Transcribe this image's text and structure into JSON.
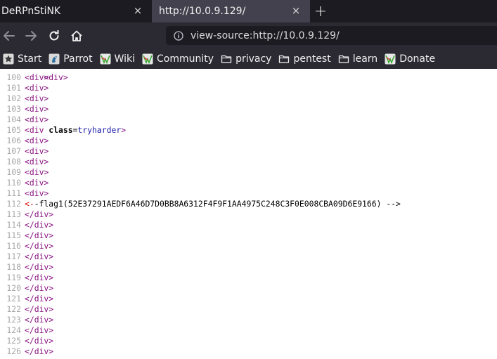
{
  "tabs": [
    {
      "title": "DeRPnStiNK",
      "active": false,
      "close_icon": "×"
    },
    {
      "title": "http://10.0.9.129/",
      "active": true,
      "close_icon": "×"
    }
  ],
  "new_tab_icon": "+",
  "nav": {
    "url": "view-source:http://10.0.9.129/"
  },
  "bookmarks": [
    {
      "label": "Start",
      "icon": "star-icon"
    },
    {
      "label": "Parrot",
      "icon": "parrot-icon"
    },
    {
      "label": "Wiki",
      "icon": "wiki-icon"
    },
    {
      "label": "Community",
      "icon": "community-icon"
    },
    {
      "label": "privacy",
      "icon": "folder-icon"
    },
    {
      "label": "pentest",
      "icon": "folder-icon"
    },
    {
      "label": "learn",
      "icon": "folder-icon"
    },
    {
      "label": "Donate",
      "icon": "donate-icon"
    }
  ],
  "source": {
    "partial_top_line": "<div>",
    "lines": [
      {
        "n": "100",
        "text": "<div>"
      },
      {
        "n": "101",
        "text": "<div>"
      },
      {
        "n": "102",
        "text": "<div>"
      },
      {
        "n": "103",
        "text": "<div>"
      },
      {
        "n": "104",
        "text": "<div>"
      },
      {
        "n": "105",
        "text": "<div class=tryharder>"
      },
      {
        "n": "106",
        "text": "<div>"
      },
      {
        "n": "107",
        "text": "<div>"
      },
      {
        "n": "108",
        "text": "<div>"
      },
      {
        "n": "109",
        "text": "<div>"
      },
      {
        "n": "110",
        "text": "<div>"
      },
      {
        "n": "111",
        "text": "<div>"
      },
      {
        "n": "112",
        "text": "<--flag1(52E37291AEDF6A46D7D0BB8A6312F4F9F1AA4975C248C3F0E008CBA09D6E9166) -->"
      },
      {
        "n": "113",
        "text": "</div>"
      },
      {
        "n": "114",
        "text": "</div>"
      },
      {
        "n": "115",
        "text": "</div>"
      },
      {
        "n": "116",
        "text": "</div>"
      },
      {
        "n": "117",
        "text": "</div>"
      },
      {
        "n": "118",
        "text": "</div>"
      },
      {
        "n": "119",
        "text": "</div>"
      },
      {
        "n": "120",
        "text": "</div>"
      },
      {
        "n": "121",
        "text": "</div>"
      },
      {
        "n": "122",
        "text": "</div>"
      },
      {
        "n": "123",
        "text": "</div>"
      },
      {
        "n": "124",
        "text": "</div>"
      },
      {
        "n": "125",
        "text": "</div>"
      },
      {
        "n": "126",
        "text": "</div>"
      }
    ]
  },
  "colors": {
    "tabbar_bg": "#1c1b22",
    "active_tab_bg": "#42414d",
    "toolbar_bg": "#2b2a33",
    "tag_color": "#881280",
    "attr_value_color": "#1a1aa6",
    "line_number_color": "#a7a7a7",
    "comment_start_color": "#e00000"
  }
}
